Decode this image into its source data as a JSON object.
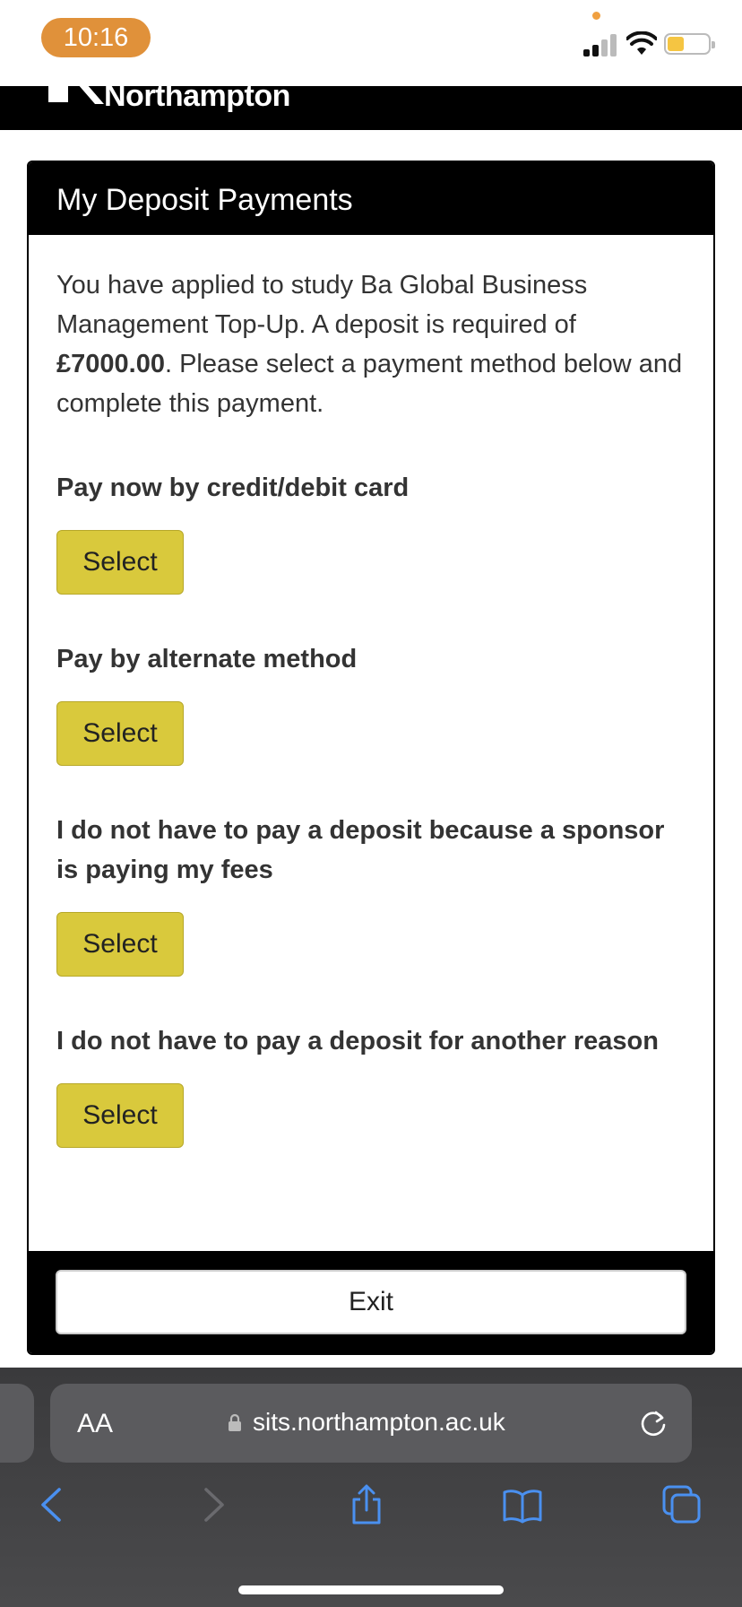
{
  "status_bar": {
    "time": "10:16"
  },
  "header": {
    "logo_text": "Northampton"
  },
  "panel": {
    "title": "My Deposit Payments",
    "intro_before": "You have applied to study Ba Global Business Management Top-Up. A deposit is required of ",
    "deposit_amount": "£7000.00",
    "intro_after": ". Please select a payment method below and complete this payment.",
    "options": [
      {
        "title": "Pay now by credit/debit card",
        "button": "Select"
      },
      {
        "title": "Pay by alternate method",
        "button": "Select"
      },
      {
        "title": "I do not have to pay a deposit because a sponsor is paying my fees",
        "button": "Select"
      },
      {
        "title": "I do not have to pay a deposit for another reason",
        "button": "Select"
      }
    ],
    "exit_label": "Exit"
  },
  "browser": {
    "text_size_label": "AA",
    "url": "sits.northampton.ac.uk"
  },
  "colors": {
    "button_yellow": "#d9c93c",
    "time_pill": "#e0913a",
    "header_bg": "#000000",
    "ios_blue": "#4a90f0"
  },
  "icons": [
    "signal-icon",
    "wifi-icon",
    "battery-icon",
    "lock-icon",
    "reload-icon",
    "back-icon",
    "forward-icon",
    "share-icon",
    "bookmarks-icon",
    "tabs-icon"
  ]
}
